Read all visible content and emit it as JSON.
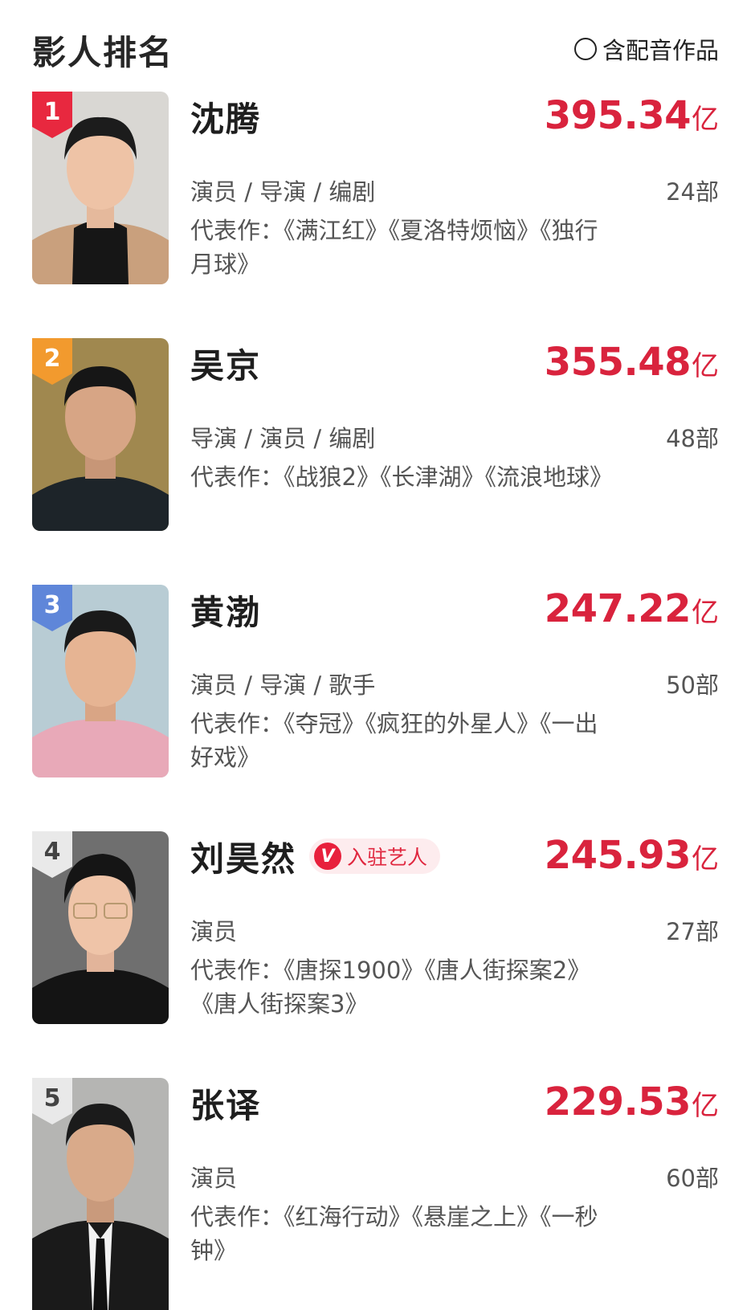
{
  "header": {
    "title": "影人排名",
    "dubbing_option": "含配音作品"
  },
  "colors": {
    "accent": "#d9233d",
    "rank_1": "#e8283f",
    "rank_2": "#f29a2e",
    "rank_3": "#5f86d9",
    "rank_other": "#e9e9e9"
  },
  "people": [
    {
      "rank": "1",
      "name": "沈腾",
      "boxoffice": "395.34",
      "unit": "亿",
      "roles": "演员 / 导演 / 编剧",
      "count": "24部",
      "works": "代表作：《满江红》《夏洛特烦恼》《独行月球》",
      "artist_tag": ""
    },
    {
      "rank": "2",
      "name": "吴京",
      "boxoffice": "355.48",
      "unit": "亿",
      "roles": "导演 / 演员 / 编剧",
      "count": "48部",
      "works": "代表作：《战狼2》《长津湖》《流浪地球》",
      "artist_tag": ""
    },
    {
      "rank": "3",
      "name": "黄渤",
      "boxoffice": "247.22",
      "unit": "亿",
      "roles": "演员 / 导演 / 歌手",
      "count": "50部",
      "works": "代表作：《夺冠》《疯狂的外星人》《一出好戏》",
      "artist_tag": ""
    },
    {
      "rank": "4",
      "name": "刘昊然",
      "boxoffice": "245.93",
      "unit": "亿",
      "roles": "演员",
      "count": "27部",
      "works": "代表作：《唐探1900》《唐人街探案2》《唐人街探案3》",
      "artist_tag": "入驻艺人",
      "artist_tag_icon": "V"
    },
    {
      "rank": "5",
      "name": "张译",
      "boxoffice": "229.53",
      "unit": "亿",
      "roles": "演员",
      "count": "60部",
      "works": "代表作：《红海行动》《悬崖之上》《一秒钟》",
      "artist_tag": ""
    }
  ]
}
